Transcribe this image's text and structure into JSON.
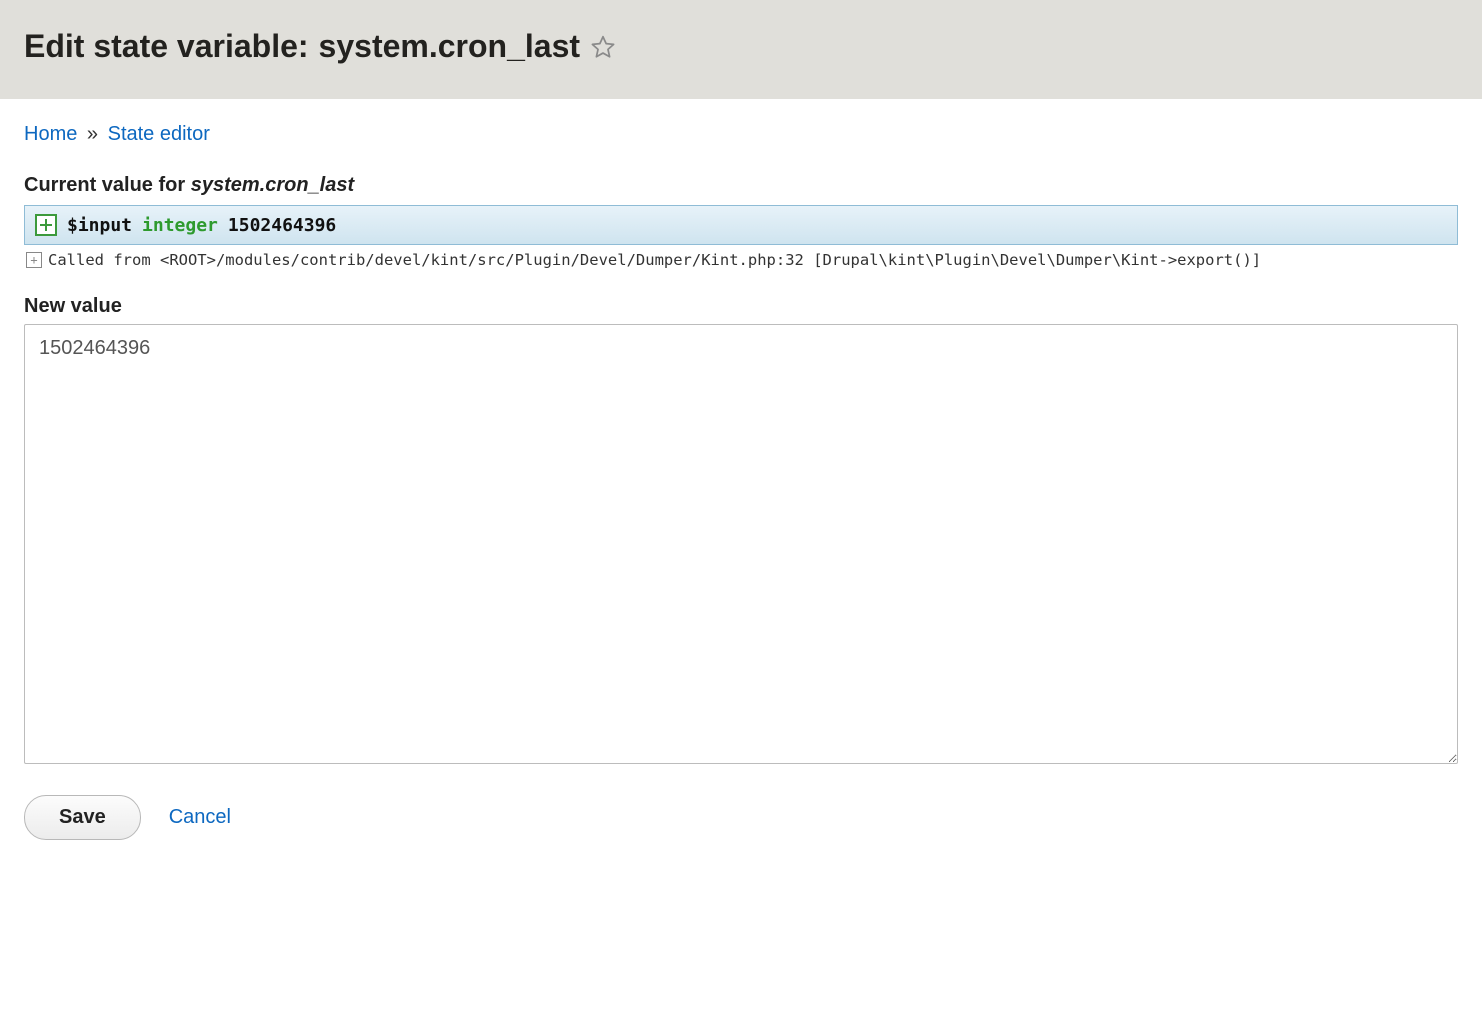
{
  "header": {
    "title_prefix": "Edit state variable: ",
    "variable_name": "system.cron_last"
  },
  "breadcrumb": {
    "items": [
      {
        "label": "Home"
      },
      {
        "label": "State editor"
      }
    ],
    "separator": "»"
  },
  "current": {
    "label_prefix": "Current value for ",
    "variable_name": "system.cron_last",
    "kint": {
      "varname": "$input",
      "type": "integer",
      "value": "1502464396"
    },
    "called_from": "Called from <ROOT>/modules/contrib/devel/kint/src/Plugin/Devel/Dumper/Kint.php:32 [Drupal\\kint\\Plugin\\Devel\\Dumper\\Kint->export()]"
  },
  "new": {
    "label": "New value",
    "value": "1502464396"
  },
  "actions": {
    "save": "Save",
    "cancel": "Cancel"
  }
}
